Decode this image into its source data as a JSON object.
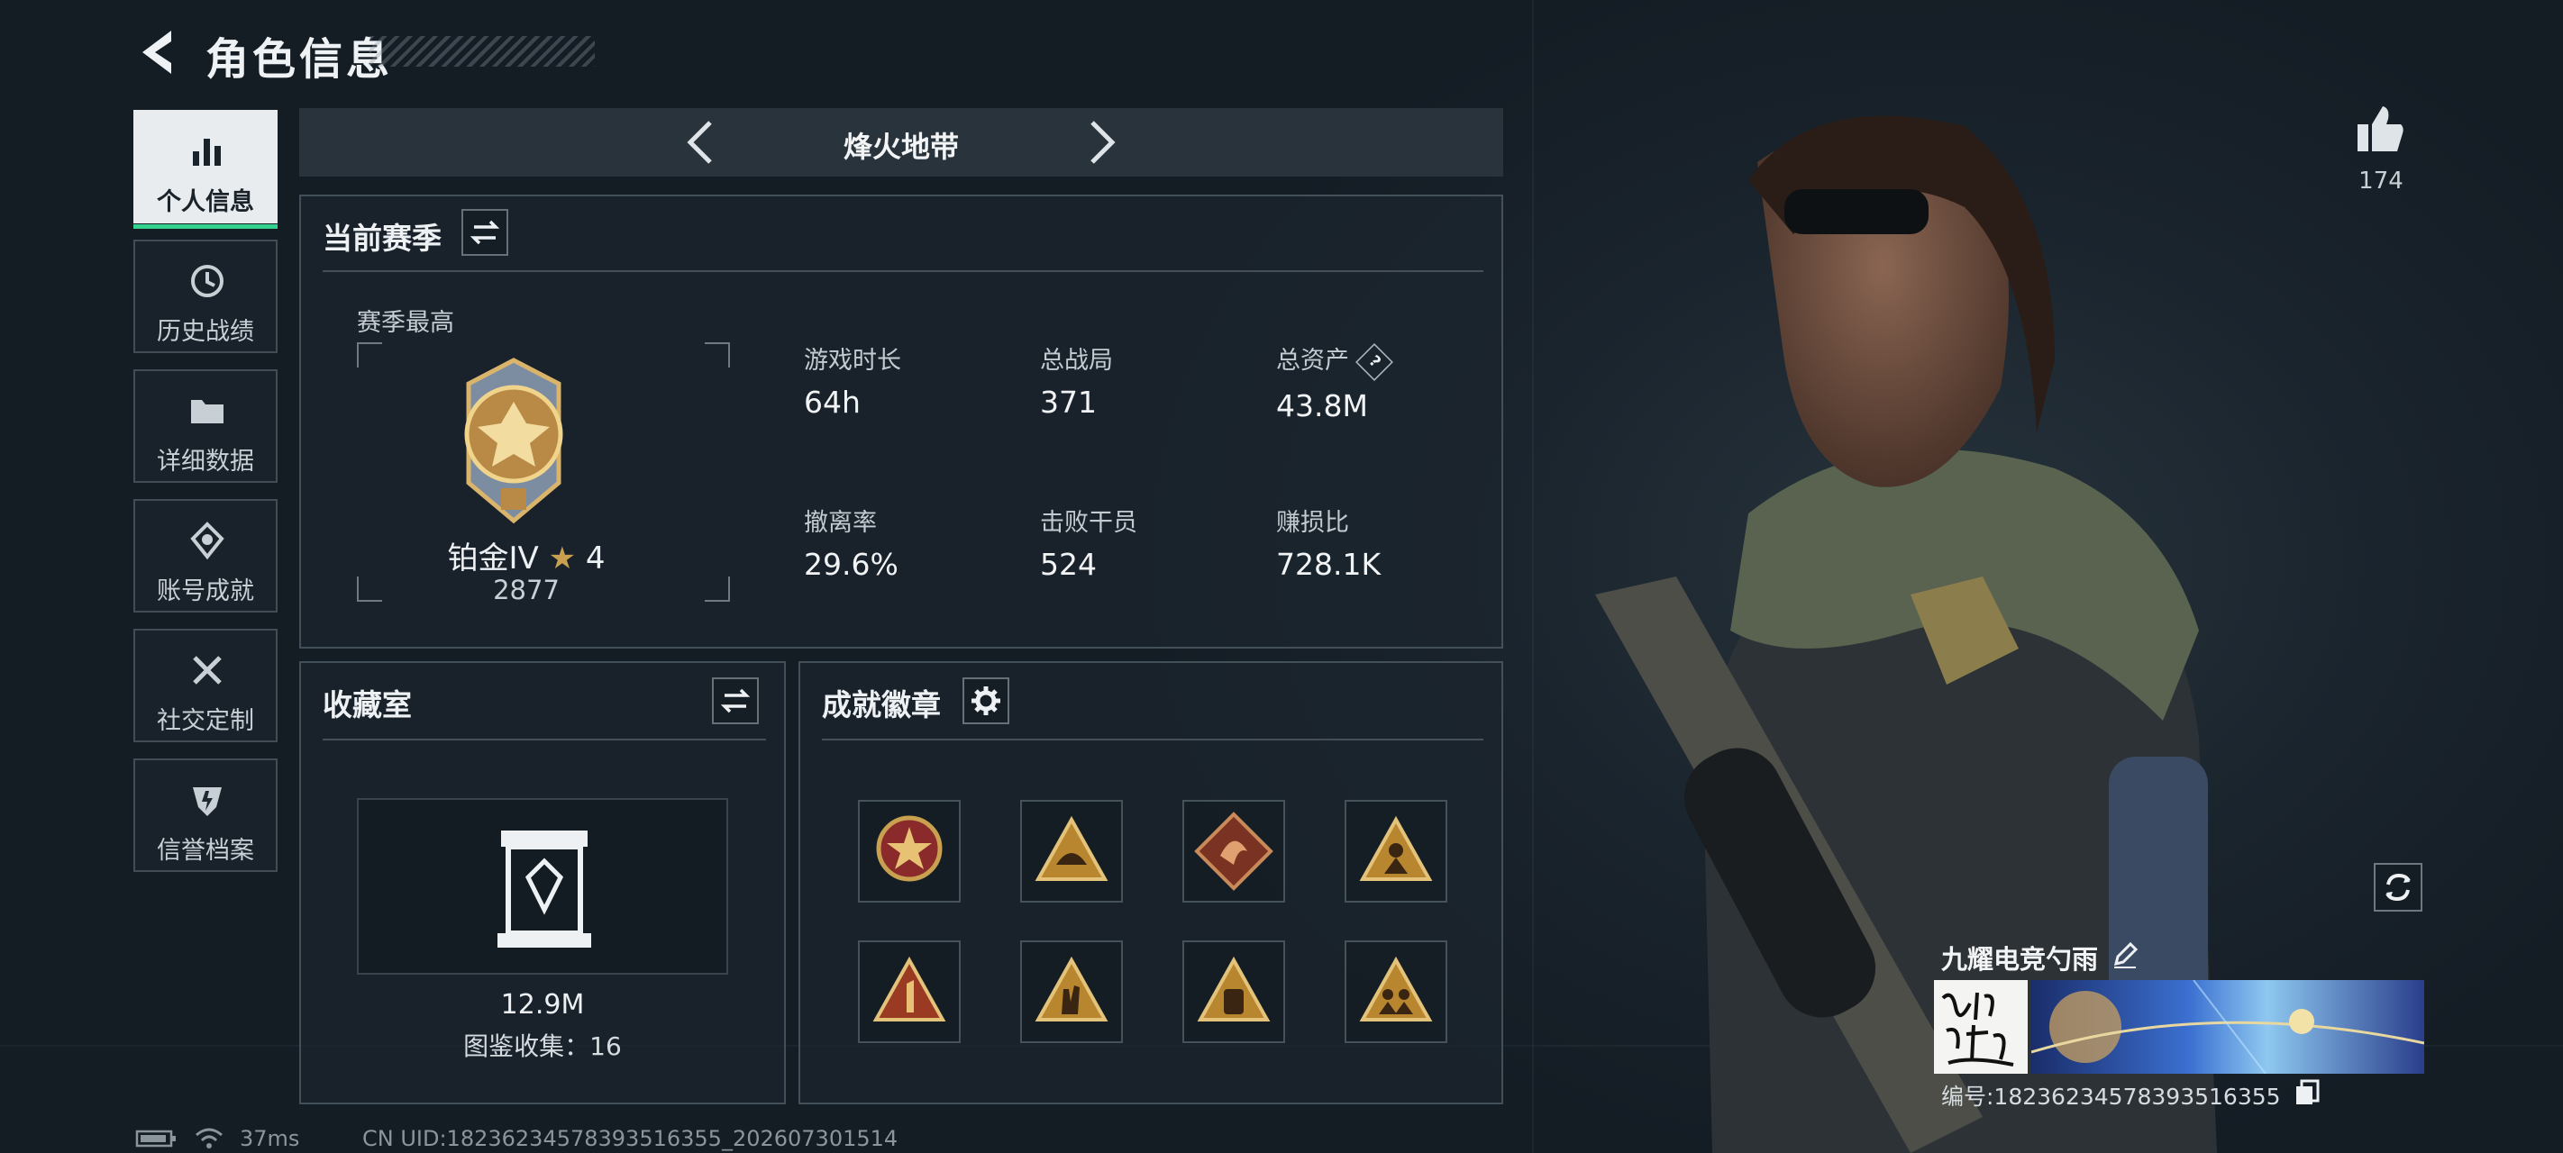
{
  "header": {
    "title": "角色信息"
  },
  "sidebar": {
    "items": [
      {
        "label": "个人信息",
        "icon": "bar-chart-icon",
        "active": true
      },
      {
        "label": "历史战绩",
        "icon": "history-clock-icon"
      },
      {
        "label": "详细数据",
        "icon": "folder-icon"
      },
      {
        "label": "账号成就",
        "icon": "achievement-icon"
      },
      {
        "label": "社交定制",
        "icon": "tools-icon"
      },
      {
        "label": "信誉档案",
        "icon": "credit-shield-icon"
      }
    ]
  },
  "mode": {
    "name": "烽火地带"
  },
  "season": {
    "title": "当前赛季",
    "peak_label": "赛季最高",
    "rank_name": "铂金IV",
    "stars": "4",
    "score": "2877",
    "stats": [
      {
        "label": "游戏时长",
        "value": "64h"
      },
      {
        "label": "总战局",
        "value": "371"
      },
      {
        "label": "总资产",
        "value": "43.8M",
        "help": "?"
      },
      {
        "label": "撤离率",
        "value": "29.6%"
      },
      {
        "label": "击败干员",
        "value": "524"
      },
      {
        "label": "赚损比",
        "value": "728.1K"
      }
    ]
  },
  "collection": {
    "title": "收藏室",
    "value": "12.9M",
    "catalog_label": "图鉴收集：16"
  },
  "achievements": {
    "title": "成就徽章",
    "badge_count": 8
  },
  "likes": {
    "count": "174"
  },
  "player": {
    "name": "九耀电竞勺雨",
    "id_label": "编号:18236234578393516355"
  },
  "status_bar": {
    "ping": "37ms",
    "uid": "CN UID:18236234578393516355_202607301514"
  },
  "colors": {
    "active_accent": "#35d18f",
    "gold": "#c9a050"
  }
}
